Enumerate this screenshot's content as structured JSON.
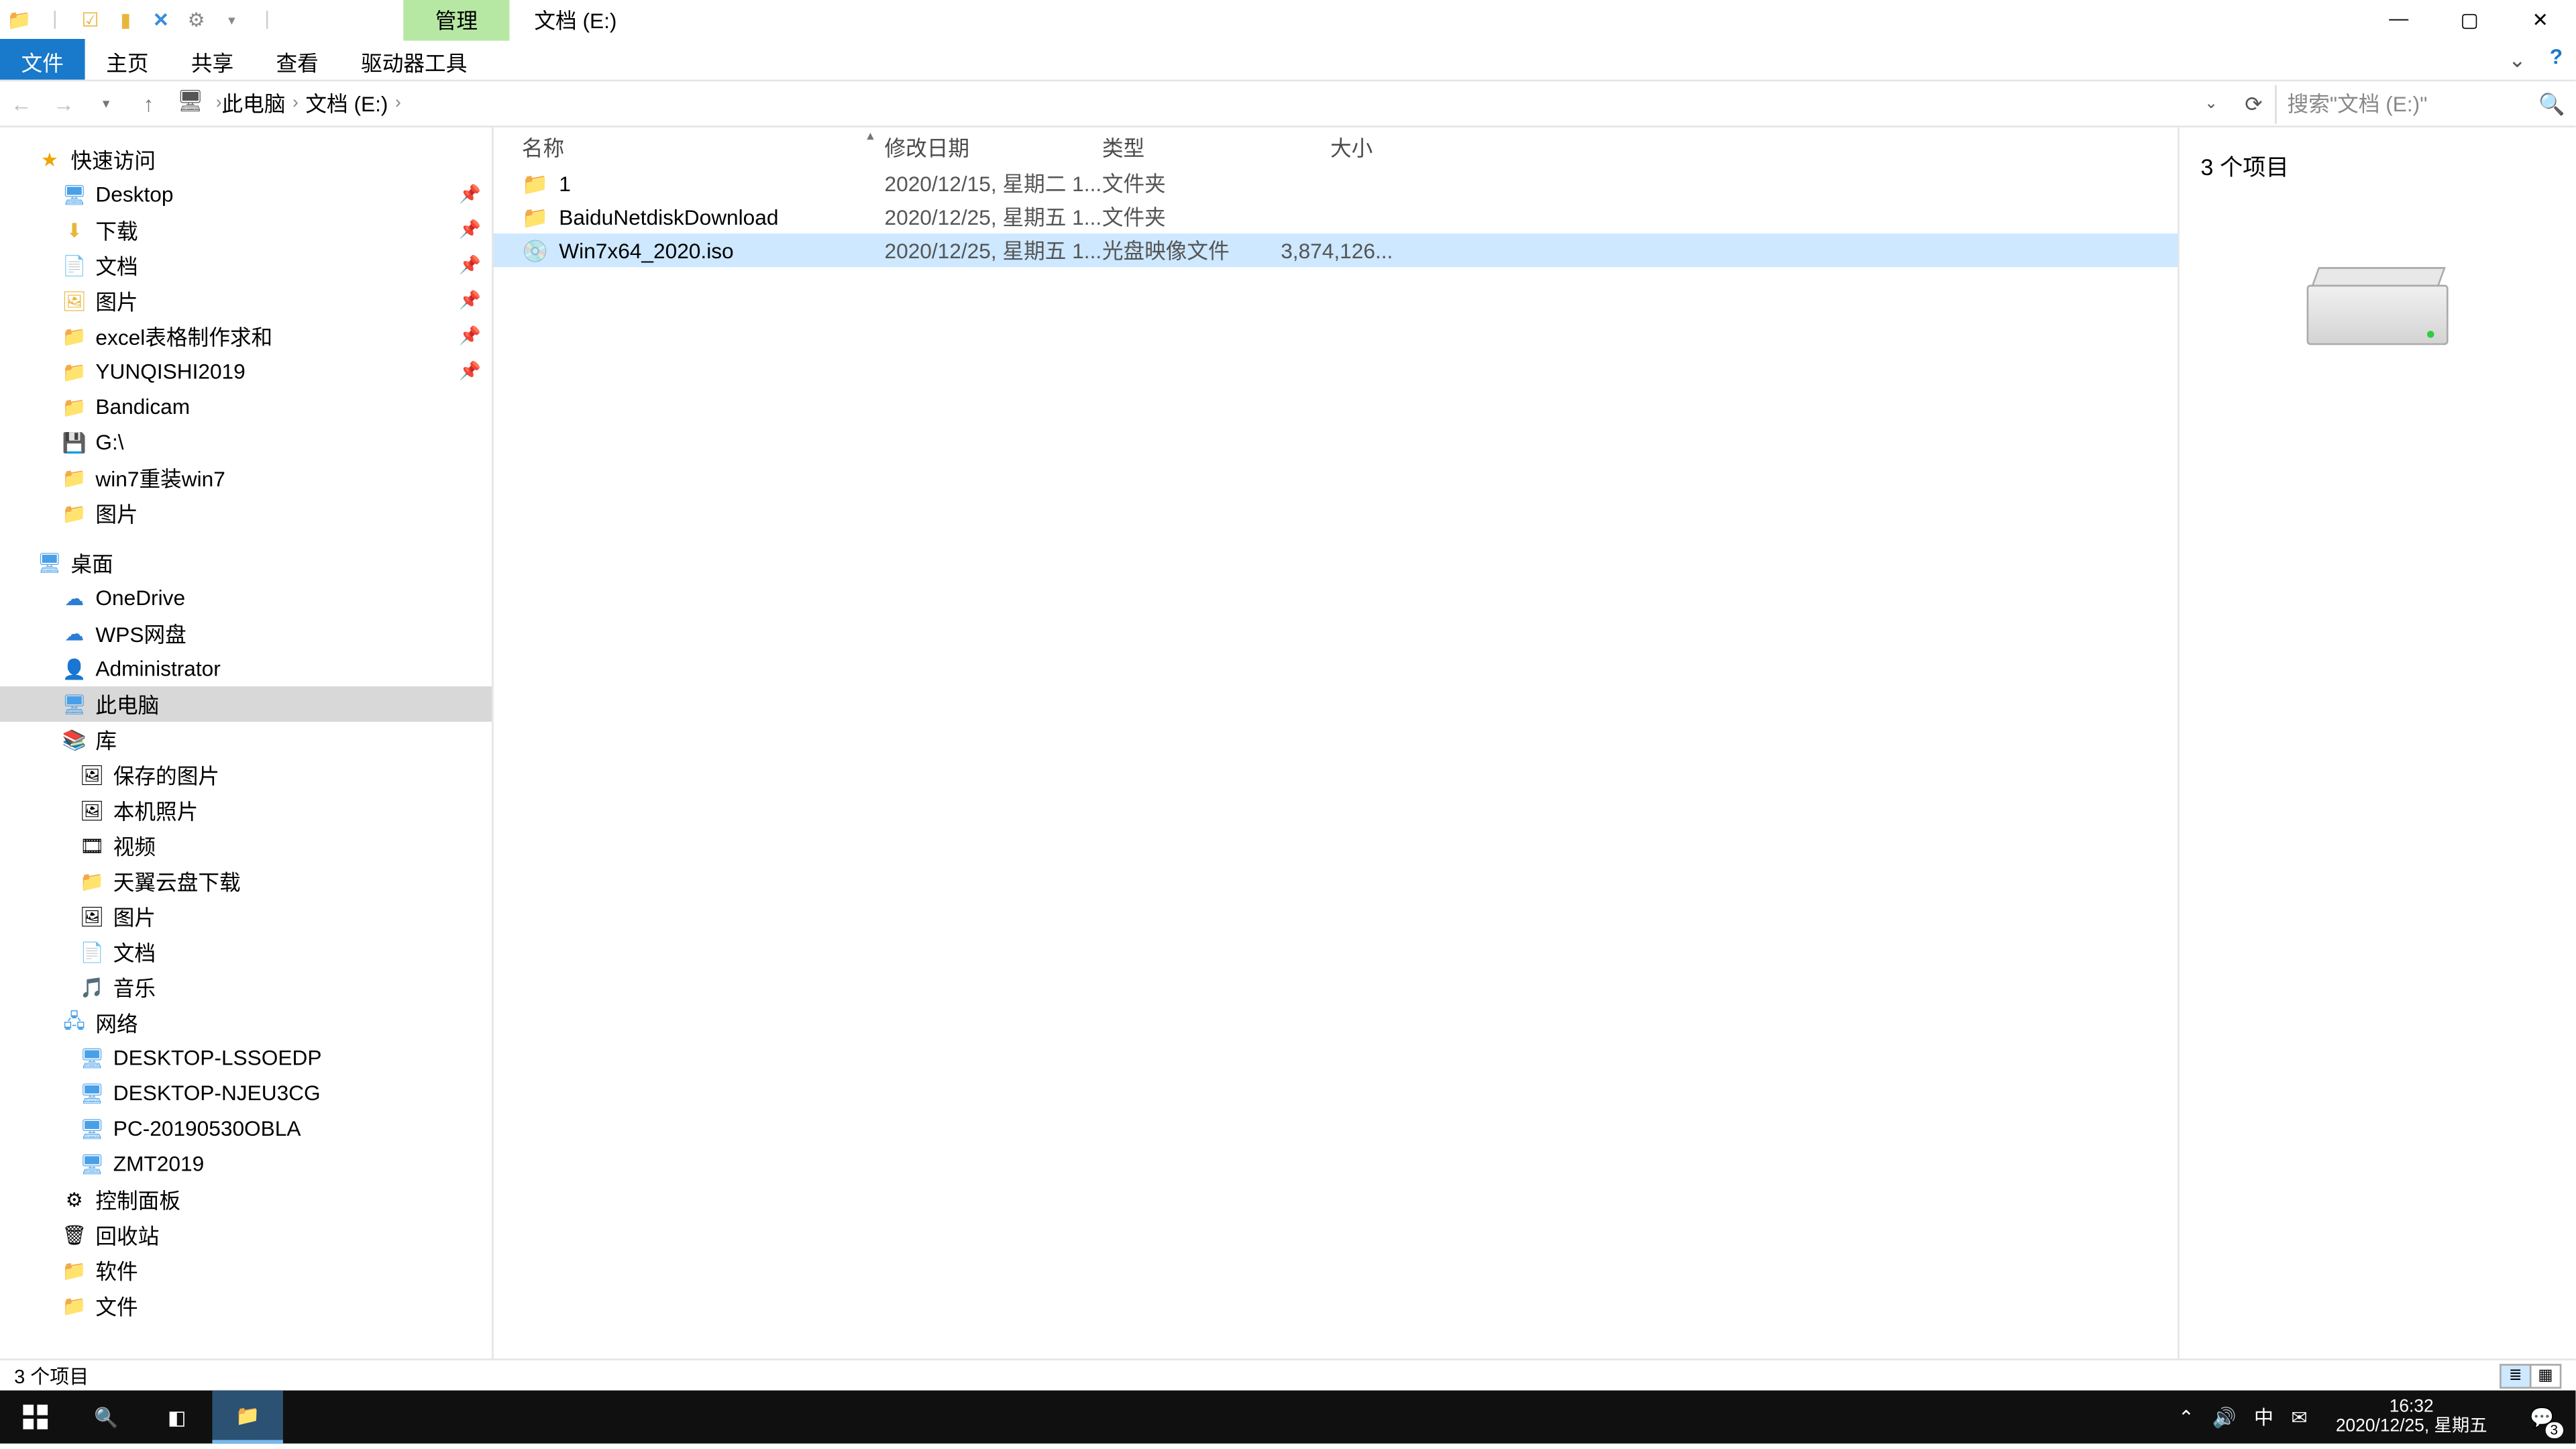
{
  "titlebar": {
    "context_tab": "管理",
    "title": "文档 (E:)"
  },
  "ribbon": {
    "tabs": [
      "文件",
      "主页",
      "共享",
      "查看",
      "驱动器工具"
    ],
    "active_index": 0
  },
  "addressbar": {
    "crumbs": [
      "此电脑",
      "文档 (E:)"
    ],
    "search_placeholder": "搜索\"文档 (E:)\""
  },
  "tree": {
    "quick_access": "快速访问",
    "quick_items": [
      {
        "label": "Desktop",
        "icon": "desktop"
      },
      {
        "label": "下载",
        "icon": "folder"
      },
      {
        "label": "文档",
        "icon": "folder"
      },
      {
        "label": "图片",
        "icon": "folder"
      },
      {
        "label": "excel表格制作求和",
        "icon": "folder"
      },
      {
        "label": "YUNQISHI2019",
        "icon": "folder"
      },
      {
        "label": "Bandicam",
        "icon": "folder"
      },
      {
        "label": "G:\\",
        "icon": "drive"
      },
      {
        "label": "win7重装win7",
        "icon": "folder"
      },
      {
        "label": "图片",
        "icon": "folder"
      }
    ],
    "desktop": "桌面",
    "desktop_items": [
      {
        "label": "OneDrive",
        "icon": "cloud"
      },
      {
        "label": "WPS网盘",
        "icon": "cloud"
      },
      {
        "label": "Administrator",
        "icon": "user"
      },
      {
        "label": "此电脑",
        "icon": "pc",
        "selected": true
      },
      {
        "label": "库",
        "icon": "lib"
      }
    ],
    "library_items": [
      {
        "label": "保存的图片"
      },
      {
        "label": "本机照片"
      },
      {
        "label": "视频"
      },
      {
        "label": "天翼云盘下载"
      },
      {
        "label": "图片"
      },
      {
        "label": "文档"
      },
      {
        "label": "音乐"
      }
    ],
    "network": "网络",
    "network_items": [
      "DESKTOP-LSSOEDP",
      "DESKTOP-NJEU3CG",
      "PC-20190530OBLA",
      "ZMT2019"
    ],
    "control_panel": "控制面板",
    "recycle": "回收站",
    "software": "软件",
    "docs": "文件"
  },
  "file_list": {
    "columns": {
      "name": "名称",
      "date": "修改日期",
      "type": "类型",
      "size": "大小"
    },
    "rows": [
      {
        "name": "1",
        "date": "2020/12/15, 星期二 1...",
        "type": "文件夹",
        "size": "",
        "icon": "folder"
      },
      {
        "name": "BaiduNetdiskDownload",
        "date": "2020/12/25, 星期五 1...",
        "type": "文件夹",
        "size": "",
        "icon": "folder"
      },
      {
        "name": "Win7x64_2020.iso",
        "date": "2020/12/25, 星期五 1...",
        "type": "光盘映像文件",
        "size": "3,874,126...",
        "icon": "iso",
        "selected": true
      }
    ]
  },
  "preview": {
    "item_count": "3 个项目"
  },
  "status": {
    "text": "3 个项目"
  },
  "taskbar": {
    "time": "16:32",
    "date": "2020/12/25, 星期五",
    "ime": "中",
    "notif_count": "3"
  }
}
